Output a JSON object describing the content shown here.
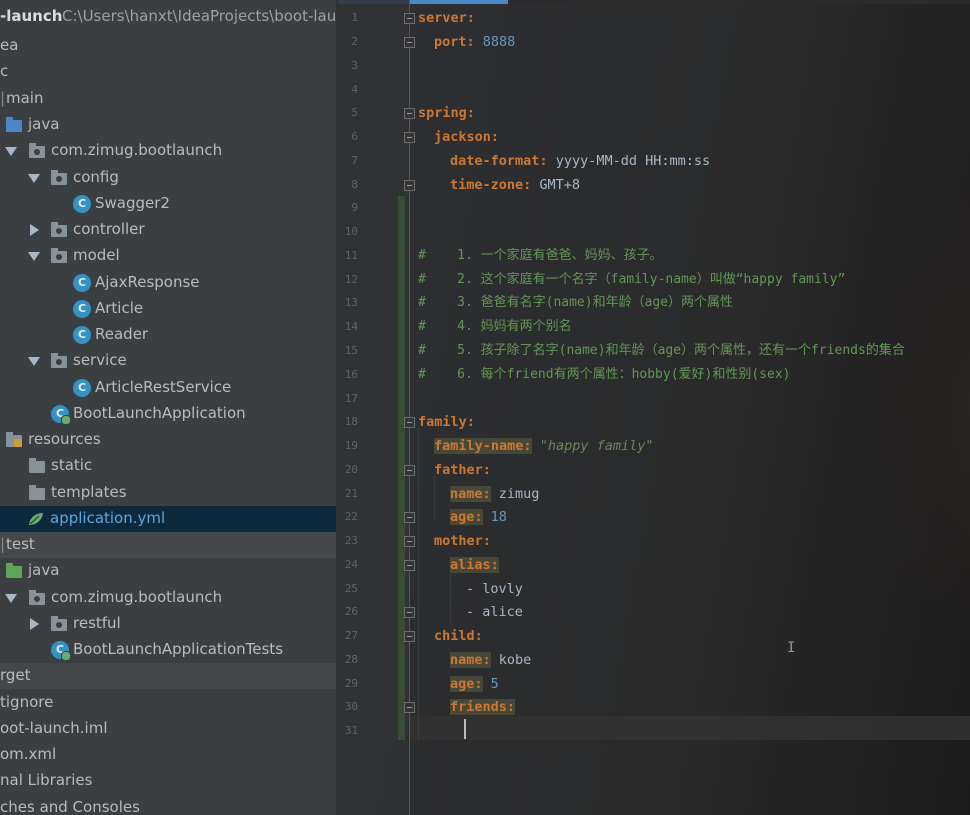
{
  "project": {
    "root_label": "-launch",
    "root_path": "C:\\Users\\hanxt\\IdeaProjects\\boot-laun",
    "items": [
      {
        "label": "ea"
      },
      {
        "label": "c"
      },
      {
        "label": "main"
      },
      {
        "label": "java"
      },
      {
        "label": "com.zimug.bootlaunch"
      },
      {
        "label": "config"
      },
      {
        "label": "Swagger2"
      },
      {
        "label": "controller"
      },
      {
        "label": "model"
      },
      {
        "label": "AjaxResponse"
      },
      {
        "label": "Article"
      },
      {
        "label": "Reader"
      },
      {
        "label": "service"
      },
      {
        "label": "ArticleRestService"
      },
      {
        "label": "BootLaunchApplication"
      },
      {
        "label": "resources"
      },
      {
        "label": "static"
      },
      {
        "label": "templates"
      },
      {
        "label": "application.yml"
      },
      {
        "label": "test"
      },
      {
        "label": "java"
      },
      {
        "label": "com.zimug.bootlaunch"
      },
      {
        "label": "restful"
      },
      {
        "label": "BootLaunchApplicationTests"
      },
      {
        "label": "rget"
      },
      {
        "label": "tignore"
      },
      {
        "label": "oot-launch.iml"
      },
      {
        "label": "om.xml"
      },
      {
        "label": "nal Libraries"
      },
      {
        "label": "ches and Consoles"
      }
    ],
    "class_icon_letter": "C"
  },
  "editor": {
    "line_numbers": [
      "1",
      "2",
      "3",
      "4",
      "5",
      "6",
      "7",
      "8",
      "9",
      "10",
      "11",
      "12",
      "13",
      "14",
      "15",
      "16",
      "17",
      "18",
      "19",
      "20",
      "21",
      "22",
      "23",
      "24",
      "25",
      "26",
      "27",
      "28",
      "29",
      "30",
      "31"
    ],
    "lines": {
      "l1_key": "server:",
      "l2_key": "port:",
      "l2_val": "8888",
      "l5_key": "spring:",
      "l6_key": "jackson:",
      "l7_key": "date-format:",
      "l7_val": "yyyy-MM-dd HH:mm:ss",
      "l8_key": "time-zone:",
      "l8_val": "GMT+8",
      "c11": "#    1. 一个家庭有爸爸、妈妈、孩子。",
      "c12": "#    2. 这个家庭有一个名字（family-name）叫做“happy family”",
      "c13": "#    3. 爸爸有名字(name)和年龄（age）两个属性",
      "c14": "#    4. 妈妈有两个别名",
      "c15": "#    5. 孩子除了名字(name)和年龄（age）两个属性，还有一个friends的集合",
      "c16": "#    6. 每个friend有两个属性：hobby(爱好)和性别(sex)",
      "l18_key": "family:",
      "l19_key": "family-name:",
      "l19_val": "\"happy family\"",
      "l20_key": "father:",
      "l21_key": "name:",
      "l21_val": "zimug",
      "l22_key": "age:",
      "l22_val": "18",
      "l23_key": "mother:",
      "l24_key": "alias:",
      "l25_val": "- lovly",
      "l26_val": "- alice",
      "l27_key": "child:",
      "l28_key": "name:",
      "l28_val": "kobe",
      "l29_key": "age:",
      "l29_val": "5",
      "l30_key": "friends:"
    }
  },
  "colors": {
    "keyword": "#cc7832",
    "number": "#6897bb",
    "string": "#6a8759",
    "comment": "#629755",
    "selection": "#0d293e"
  }
}
